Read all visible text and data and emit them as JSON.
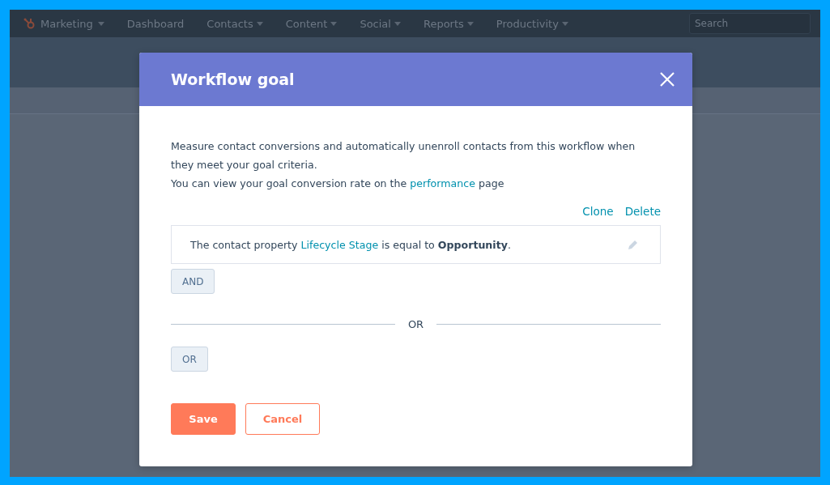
{
  "nav": {
    "brand": "Marketing",
    "items": [
      {
        "label": "Dashboard",
        "dropdown": false
      },
      {
        "label": "Contacts",
        "dropdown": true
      },
      {
        "label": "Content",
        "dropdown": true
      },
      {
        "label": "Social",
        "dropdown": true
      },
      {
        "label": "Reports",
        "dropdown": true
      },
      {
        "label": "Productivity",
        "dropdown": true
      }
    ],
    "search": {
      "placeholder": "Search"
    }
  },
  "dialog": {
    "title": "Workflow goal",
    "description": "Measure contact conversions and automatically unenroll contacts from this workflow when they meet your goal criteria.",
    "note": {
      "before": "You can view your goal conversion rate on the",
      "link": "performance",
      "after": "page"
    },
    "actions": [
      "Clone",
      "Delete"
    ],
    "rule": {
      "before": "The contact property",
      "property": "Lifecycle Stage",
      "after": "is equal to **Opportunity**."
    },
    "and_button": "AND",
    "divider": "OR",
    "or_button": "OR",
    "buttons": [
      {
        "label": "Save",
        "kind": "primary"
      },
      {
        "label": "Cancel",
        "kind": "secondary"
      }
    ]
  }
}
